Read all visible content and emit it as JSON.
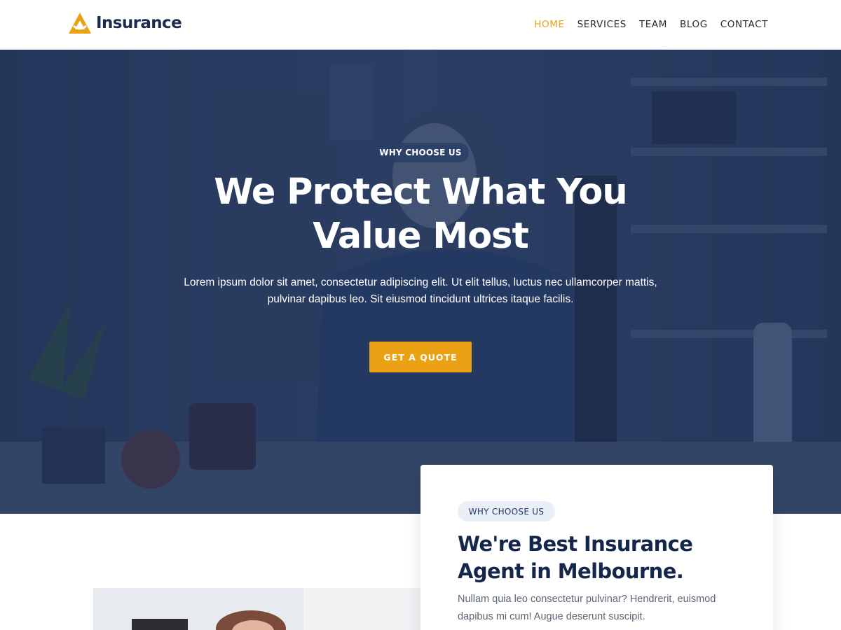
{
  "brand": {
    "name": "Insurance",
    "accent_color": "#eaa214",
    "navy_color": "#1b2c4f"
  },
  "nav": {
    "items": [
      {
        "label": "HOME",
        "active": true
      },
      {
        "label": "SERVICES",
        "active": false
      },
      {
        "label": "TEAM",
        "active": false
      },
      {
        "label": "BLOG",
        "active": false
      },
      {
        "label": "CONTACT",
        "active": false
      }
    ]
  },
  "hero": {
    "eyebrow": "WHY CHOOSE US",
    "title_line1": "We Protect What You",
    "title_line2": "Value Most",
    "text_line1": "Lorem ipsum dolor sit amet, consectetur adipiscing elit. Ut elit tellus, luctus nec ullamcorper mattis,",
    "text_line2": "pulvinar dapibus leo. Sit eiusmod tincidunt ultrices itaque facilis.",
    "cta_label": "GET A QUOTE"
  },
  "about": {
    "eyebrow": "WHY CHOOSE US",
    "title_line1": "We're Best Insurance",
    "title_line2": "Agent in Melbourne.",
    "text_line1": "Nullam quia leo consectetur pulvinar? Hendrerit, euismod",
    "text_line2": "dapibus mi cum! Augue deserunt suscipit."
  },
  "icons": [
    "logo-icon",
    "hero-photo-icon",
    "agent-photo-icon"
  ]
}
